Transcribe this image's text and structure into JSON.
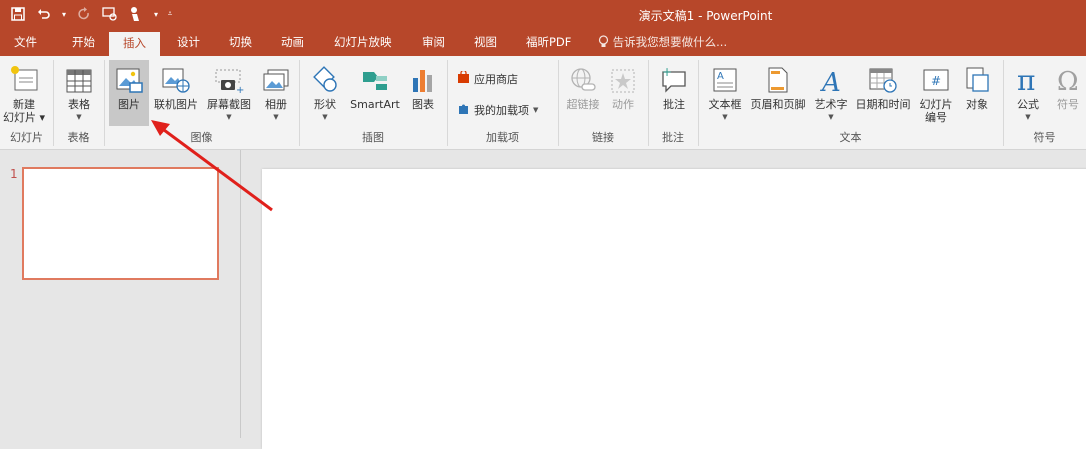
{
  "window": {
    "title": "演示文稿1 - PowerPoint"
  },
  "qat": [
    {
      "name": "save-icon",
      "glyph": "🖫"
    },
    {
      "name": "undo-icon",
      "glyph": "↶"
    },
    {
      "name": "redo-icon",
      "glyph": "↻"
    },
    {
      "name": "touch-mode-icon",
      "glyph": "☜"
    },
    {
      "name": "start-from-beginning-icon",
      "glyph": "▸"
    }
  ],
  "tabs": [
    "文件",
    "开始",
    "插入",
    "设计",
    "切换",
    "动画",
    "幻灯片放映",
    "审阅",
    "视图",
    "福昕PDF"
  ],
  "tell_me": "告诉我您想要做什么...",
  "ribbon": {
    "new_slide": [
      "新建",
      "幻灯片"
    ],
    "table": "表格",
    "picture": "图片",
    "online_picture": "联机图片",
    "screenshot": "屏幕截图",
    "album": "相册",
    "shapes": "形状",
    "smartart": "SmartArt",
    "chart": "图表",
    "store": "应用商店",
    "my_addins": "我的加载项",
    "hyperlink": "超链接",
    "action": "动作",
    "comment": "批注",
    "textbox": "文本框",
    "header_footer": "页眉和页脚",
    "wordart": "艺术字",
    "datetime": "日期和时间",
    "slide_number": [
      "幻灯片",
      "编号"
    ],
    "object": "对象",
    "equation": "公式",
    "symbol": "符号"
  },
  "groups": {
    "slides": "幻灯片",
    "tables": "表格",
    "images": "图像",
    "illustrations": "插图",
    "addins": "加载项",
    "links": "链接",
    "comments": "批注",
    "text": "文本",
    "symbols": "符号"
  },
  "thumbnails": [
    {
      "number": "1"
    }
  ],
  "colors": {
    "accent": "#b7472a",
    "arrow": "#e0201b",
    "thumb_border": "#e07a5f"
  }
}
